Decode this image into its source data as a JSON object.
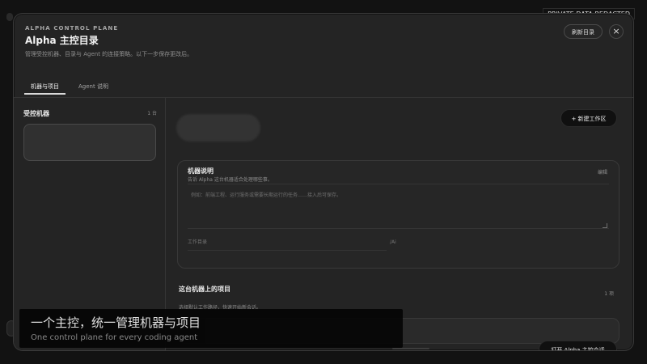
{
  "overlay": {
    "privacy_label": "PRIVATE DATA REDACTED",
    "banner_title": "一个主控，统一管理机器与项目",
    "banner_subtitle": "One control plane for every coding agent"
  },
  "modal": {
    "kicker": "ALPHA CONTROL PLANE",
    "title": "Alpha 主控目录",
    "subtitle": "管理受控机器、目录与 Agent 的连接策略。以下一步保存更改后。",
    "actions": {
      "refresh_label": "刷新目录",
      "close_icon": "×"
    }
  },
  "tabs": [
    {
      "label": "机器与项目",
      "active": true
    },
    {
      "label": "Agent 说明",
      "active": false
    }
  ],
  "sidebar": {
    "title": "受控机器",
    "count": "1 台"
  },
  "main": {
    "new_workspace_label": "+ 新建工作区",
    "description": {
      "title": "机器说明",
      "subtitle": "告诉 Alpha 这台机器适合处理哪些事。",
      "edit_label": "编辑",
      "placeholder": "例如：前端工程、运行服务或需要长期运行的任务……接入后可保存。",
      "path_label": "工作目录",
      "path_value": "/Ai"
    },
    "projects": {
      "title": "这台机器上的项目",
      "subtitle": "选择默认工作路径，快速开始新会话。",
      "count": "1 项"
    },
    "open_chat_label": "打开 Alpha 主控会话"
  }
}
